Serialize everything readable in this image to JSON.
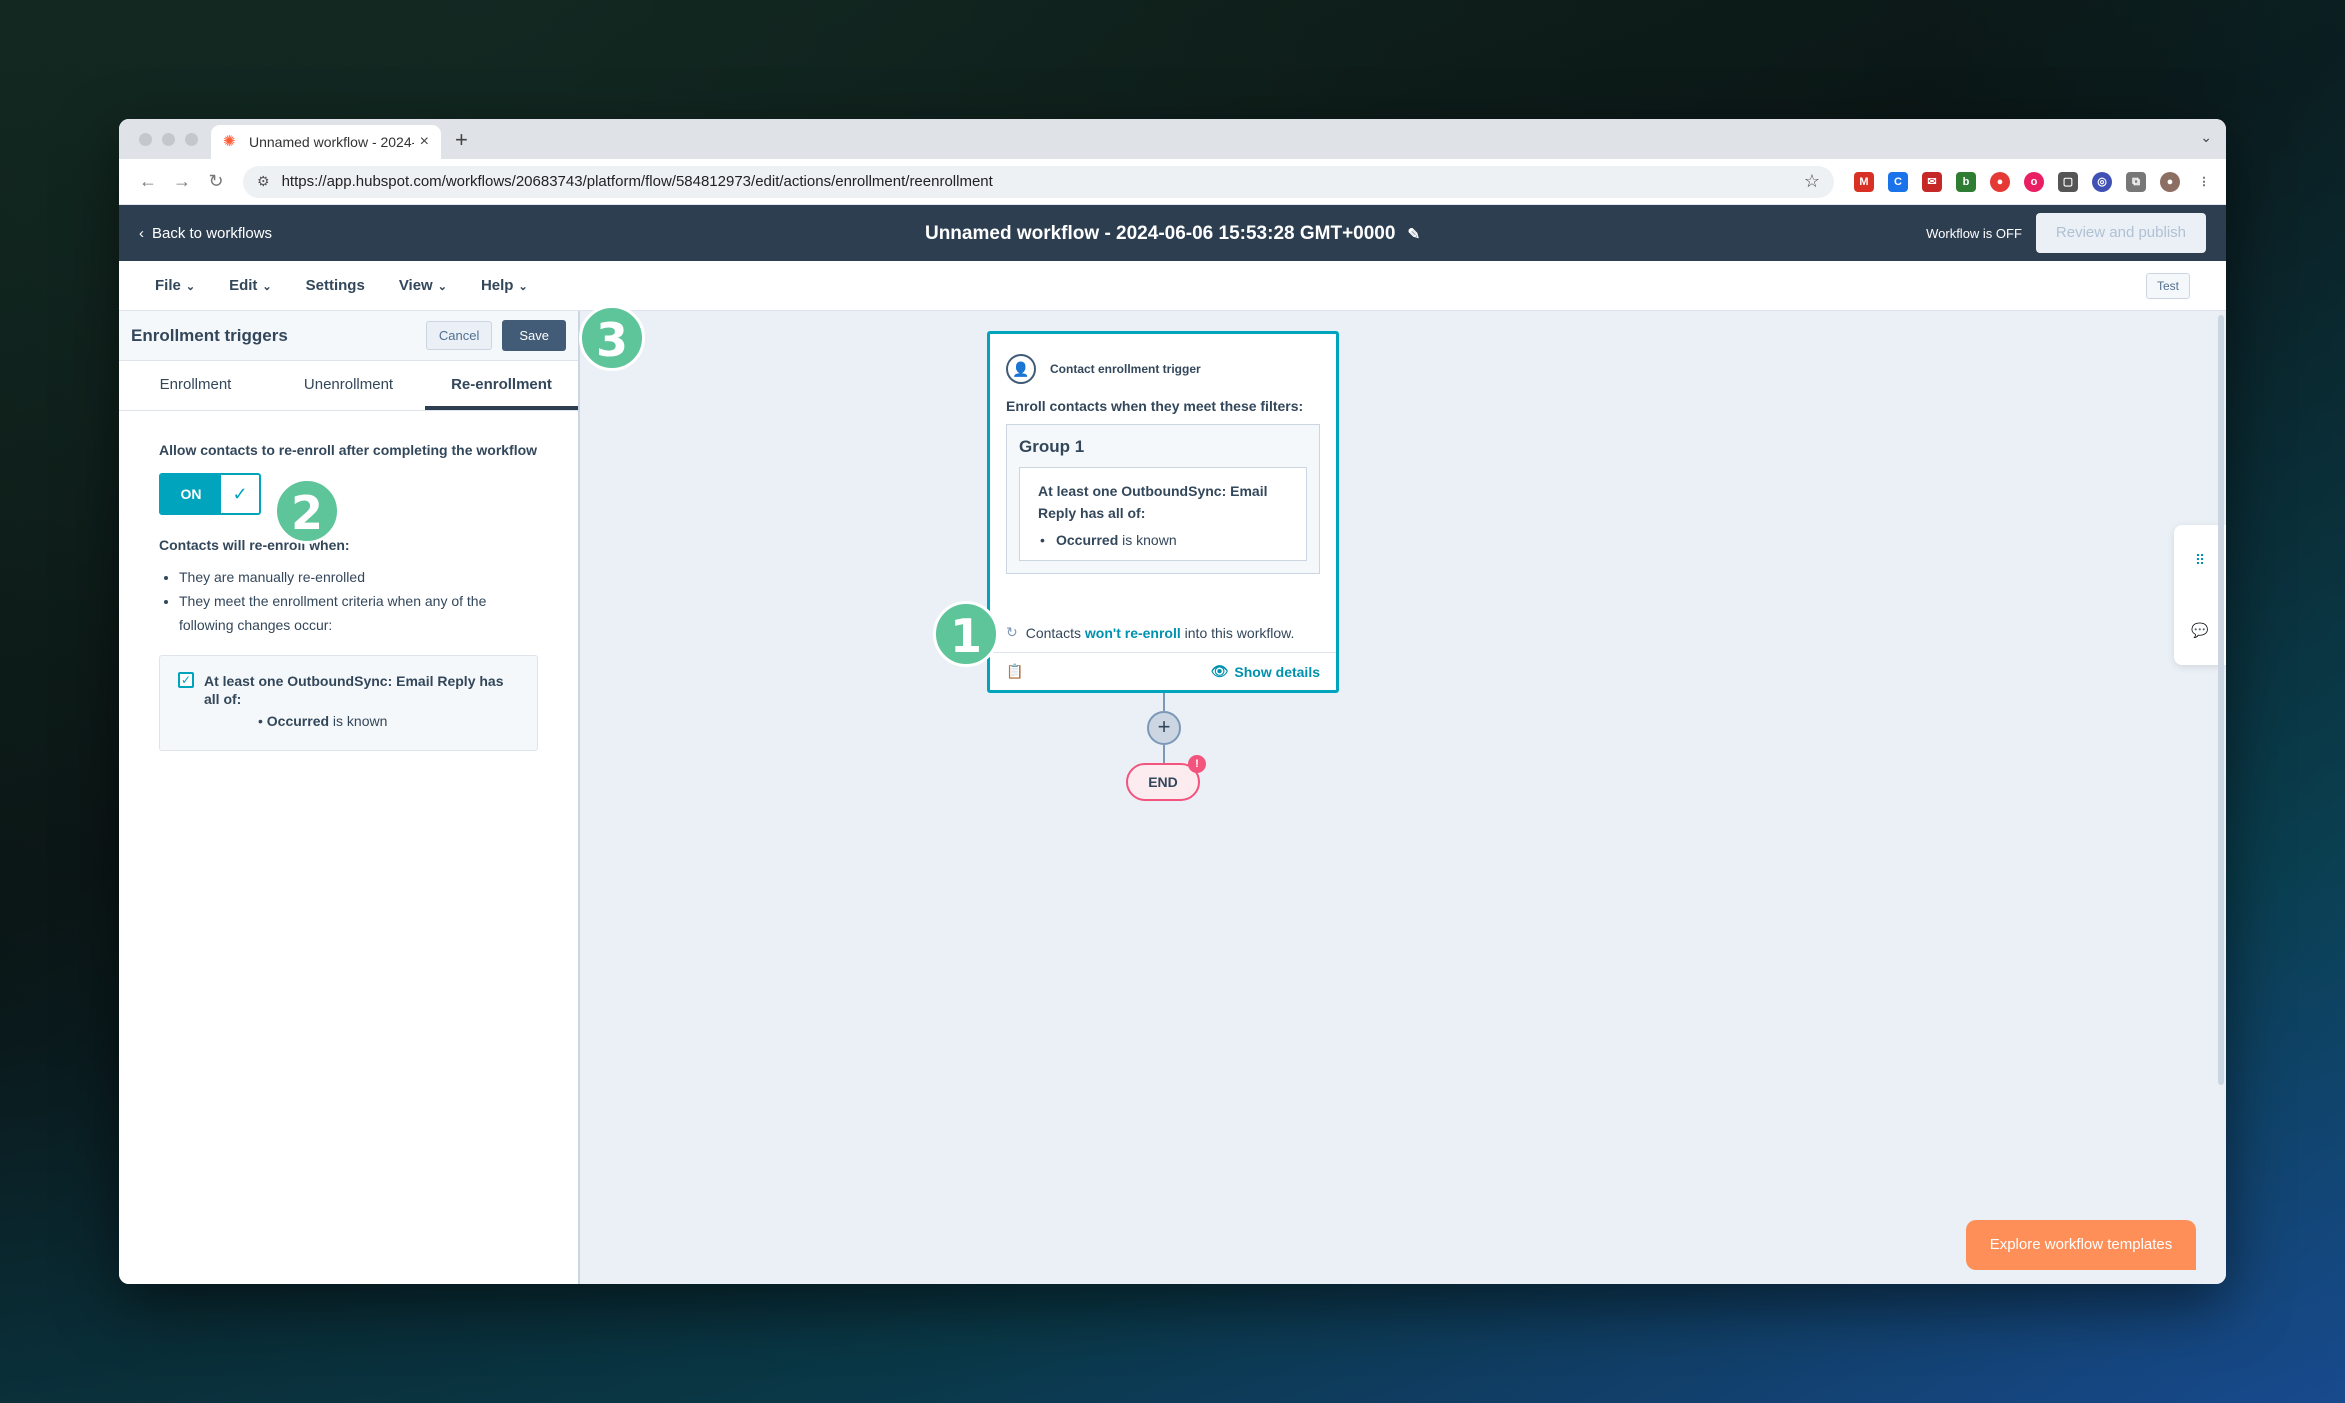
{
  "browser": {
    "tab_title": "Unnamed workflow - 2024-0",
    "url": "https://app.hubspot.com/workflows/20683743/platform/flow/584812973/edit/actions/enrollment/reenrollment"
  },
  "header": {
    "back_label": "Back to workflows",
    "workflow_title": "Unnamed workflow - 2024-06-06 15:53:28 GMT+0000",
    "status": "Workflow is OFF",
    "publish_label": "Review and publish"
  },
  "menu": {
    "items": [
      "File",
      "Edit",
      "Settings",
      "View",
      "Help"
    ],
    "test_label": "Test"
  },
  "panel": {
    "title": "Enrollment triggers",
    "cancel_label": "Cancel",
    "save_label": "Save",
    "tabs": [
      "Enrollment",
      "Unenrollment",
      "Re-enrollment"
    ],
    "active_tab": "Re-enrollment",
    "allow_label": "Allow contacts to re-enroll after completing the workflow",
    "toggle_label": "ON",
    "reenroll_when": "Contacts will re-enroll when:",
    "conditions": [
      "They are manually re-enrolled",
      "They meet the enrollment criteria when any of the following changes occur:"
    ],
    "criteria_title": "At least one OutboundSync: Email Reply has all of:",
    "criteria_item_bold": "Occurred",
    "criteria_item_rest": " is known"
  },
  "canvas": {
    "trigger_label": "Contact enrollment trigger",
    "trigger_sub": "Enroll contacts when they meet these filters:",
    "group_title": "Group 1",
    "filter_title": "At least one OutboundSync: Email Reply has all of:",
    "filter_item_bold": "Occurred",
    "filter_item_rest": " is known",
    "note_prefix": "Contacts ",
    "note_accent": "won't re-enroll",
    "note_suffix": " into this workflow.",
    "show_details": "Show details",
    "end_label": "END",
    "end_alert": "!",
    "explore_label": "Explore workflow templates"
  },
  "badges": [
    "1",
    "2",
    "3"
  ],
  "colors": {
    "header_bg": "#2d3e50",
    "accent": "#00a4bd",
    "badge": "#5ec49a",
    "cta": "#ff8f59",
    "end_border": "#f2547d"
  }
}
